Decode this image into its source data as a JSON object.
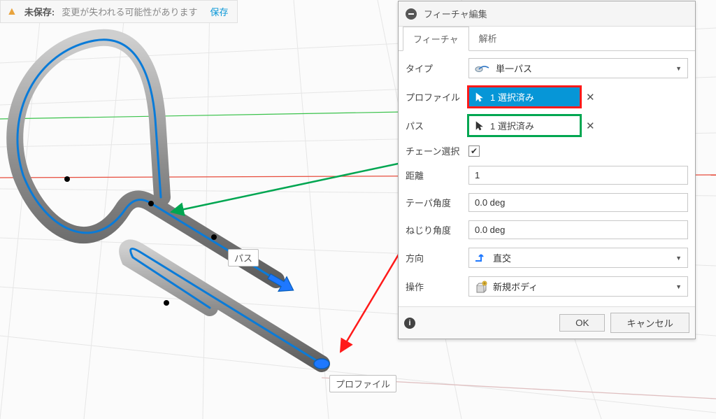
{
  "colors": {
    "accent": "#0696d7",
    "warning": "#e8a33d",
    "highlight_red": "#ff1a1a",
    "highlight_green": "#00a651",
    "arrow_blue": "#1e78ff"
  },
  "unsaved_bar": {
    "bold_text": "未保存:",
    "message": "変更が失われる可能性があります",
    "save_link": "保存"
  },
  "viewport": {
    "callout_path": "パス",
    "callout_profile": "プロファイル"
  },
  "panel": {
    "title": "フィーチャ編集",
    "tabs": {
      "feature": "フィーチャ",
      "analysis": "解析"
    },
    "rows": {
      "type": {
        "label": "タイプ",
        "value": "単一パス"
      },
      "profile": {
        "label": "プロファイル",
        "selection_text": "1 選択済み"
      },
      "path": {
        "label": "パス",
        "selection_text": "1 選択済み"
      },
      "chain": {
        "label": "チェーン選択",
        "checked": true
      },
      "distance": {
        "label": "距離",
        "value": "1"
      },
      "taper": {
        "label": "テーパ角度",
        "value": "0.0 deg"
      },
      "twist": {
        "label": "ねじり角度",
        "value": "0.0 deg"
      },
      "orientation": {
        "label": "方向",
        "value": "直交"
      },
      "operation": {
        "label": "操作",
        "value": "新規ボディ"
      }
    },
    "footer": {
      "ok": "OK",
      "cancel": "キャンセル"
    }
  }
}
